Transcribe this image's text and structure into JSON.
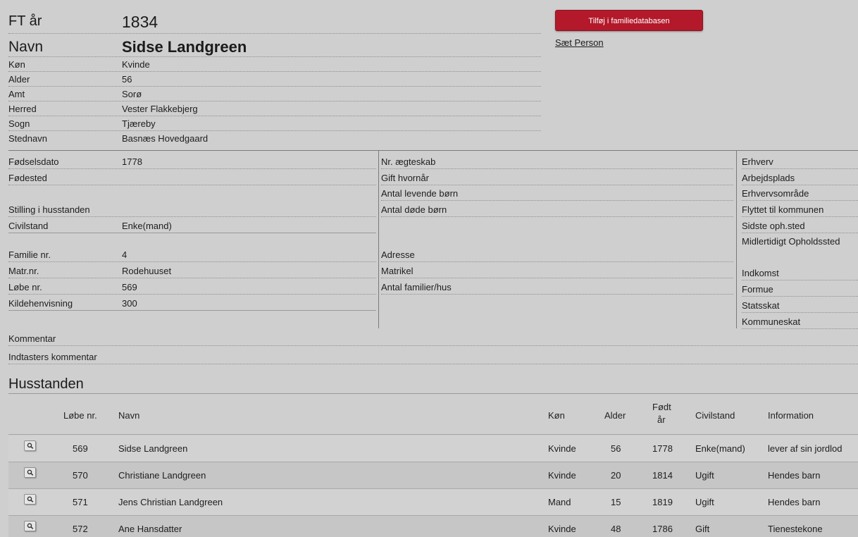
{
  "header": {
    "ft_label": "FT år",
    "ft_value": "1834",
    "navn_label": "Navn",
    "navn_value": "Sidse Landgreen",
    "add_button": "Tilføj i familiedatabasen",
    "saet_person": "Sæt Person"
  },
  "top_fields": [
    {
      "label": "Køn",
      "value": "Kvinde"
    },
    {
      "label": "Alder",
      "value": "56"
    },
    {
      "label": "Amt",
      "value": "Sorø"
    },
    {
      "label": "Herred",
      "value": "Vester Flakkebjerg"
    },
    {
      "label": "Sogn",
      "value": "Tjæreby"
    },
    {
      "label": "Stednavn",
      "value": "Basnæs Hovedgaard"
    }
  ],
  "left_fields": [
    {
      "label": "Fødselsdato",
      "value": "1778"
    },
    {
      "label": "Fødested",
      "value": ""
    },
    {
      "label": "Stilling i husstanden",
      "value": ""
    },
    {
      "label": "Civilstand",
      "value": "Enke(mand)"
    },
    {
      "label": "Familie nr.",
      "value": "4"
    },
    {
      "label": "Matr.nr.",
      "value": "Rodehuuset"
    },
    {
      "label": "Løbe nr.",
      "value": "569"
    },
    {
      "label": "Kildehenvisning",
      "value": "300"
    }
  ],
  "middle_fields": [
    {
      "label": "Nr. ægteskab"
    },
    {
      "label": "Gift hvornår"
    },
    {
      "label": "Antal levende børn"
    },
    {
      "label": "Antal døde børn"
    },
    {
      "label": "Adresse"
    },
    {
      "label": "Matrikel"
    },
    {
      "label": "Antal familier/hus"
    }
  ],
  "right_fields": [
    {
      "label": "Erhverv"
    },
    {
      "label": "Arbejdsplads"
    },
    {
      "label": "Erhvervsområde"
    },
    {
      "label": "Flyttet til kommunen"
    },
    {
      "label": "Sidste oph.sted"
    },
    {
      "label": "Midlertidigt Opholdssted"
    },
    {
      "label": "Indkomst"
    },
    {
      "label": "Formue"
    },
    {
      "label": "Statsskat"
    },
    {
      "label": "Kommuneskat"
    }
  ],
  "comments": {
    "kommentar": "Kommentar",
    "indtasters": "Indtasters kommentar"
  },
  "household": {
    "title": "Husstanden",
    "columns": {
      "lobe": "Løbe nr.",
      "navn": "Navn",
      "kon": "Køn",
      "alder": "Alder",
      "fodt1": "Født",
      "fodt2": "år",
      "civil": "Civilstand",
      "info": "Information"
    },
    "rows": [
      {
        "lobe": "569",
        "navn": "Sidse Landgreen",
        "kon": "Kvinde",
        "alder": "56",
        "fodt": "1778",
        "civil": "Enke(mand)",
        "info": "lever af sin jordlod"
      },
      {
        "lobe": "570",
        "navn": "Christiane Landgreen",
        "kon": "Kvinde",
        "alder": "20",
        "fodt": "1814",
        "civil": "Ugift",
        "info": "Hendes barn"
      },
      {
        "lobe": "571",
        "navn": "Jens Christian Landgreen",
        "kon": "Mand",
        "alder": "15",
        "fodt": "1819",
        "civil": "Ugift",
        "info": "Hendes barn"
      },
      {
        "lobe": "572",
        "navn": "Ane Hansdatter",
        "kon": "Kvinde",
        "alder": "48",
        "fodt": "1786",
        "civil": "Gift",
        "info": "Tienestekone"
      }
    ]
  },
  "colors": {
    "background": "#cfcfcf",
    "button": "#b3192a"
  },
  "icons": {
    "row_view": "magnifier-icon"
  }
}
